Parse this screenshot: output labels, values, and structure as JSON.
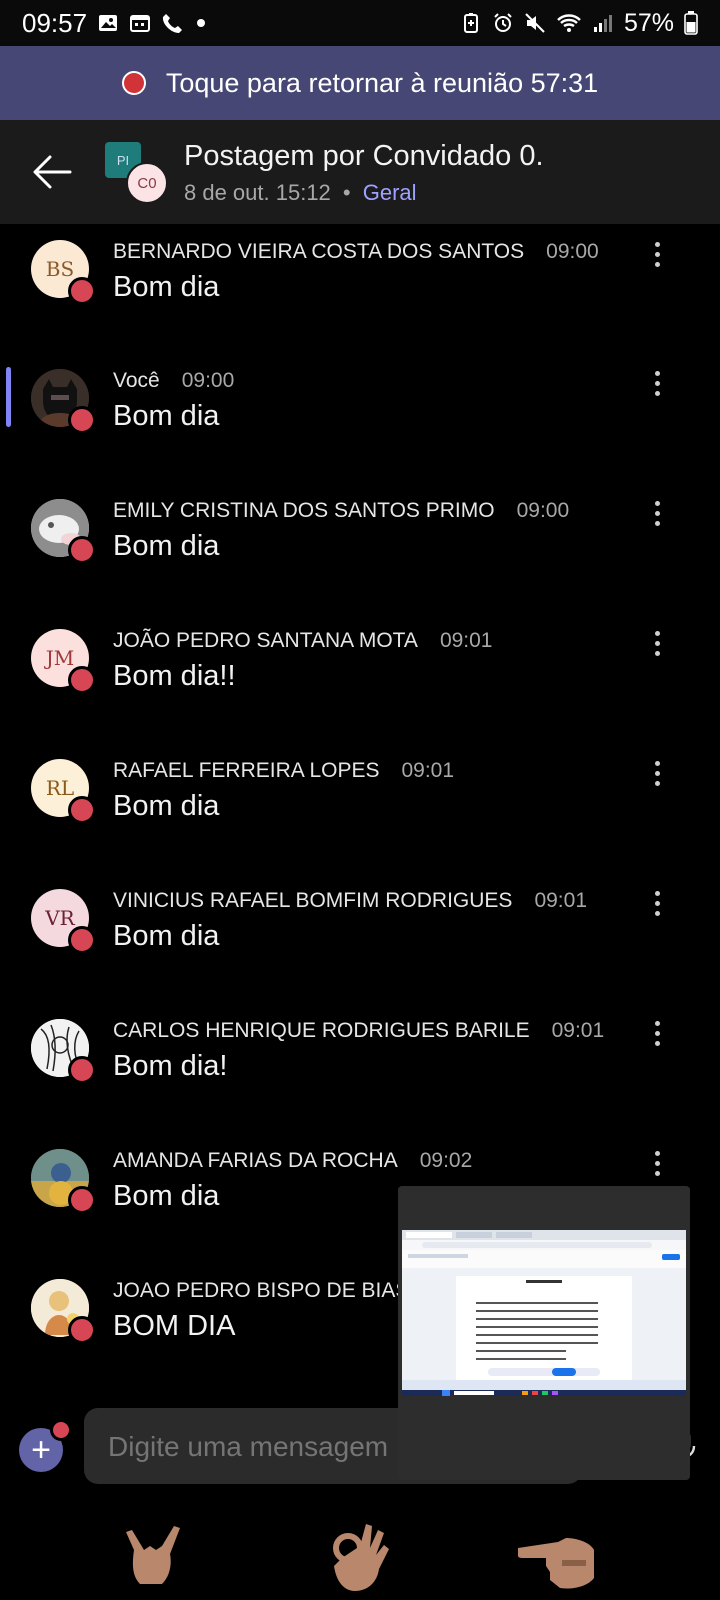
{
  "status_bar": {
    "time": "09:57",
    "battery": "57%"
  },
  "banner": {
    "text": "Toque para retornar à reunião 57:31"
  },
  "header": {
    "title": "Postagem por Convidado 0.",
    "date": "8 de out. 15:12",
    "separator": "•",
    "channel": "Geral",
    "avatar_team": "PI",
    "avatar_user": "C0"
  },
  "messages": [
    {
      "initials": "BS",
      "sender": "BERNARDO VIEIRA COSTA DOS SANTOS",
      "time": "09:00",
      "text": "Bom dia"
    },
    {
      "initials": "",
      "sender": "Você",
      "time": "09:00",
      "text": "Bom dia"
    },
    {
      "initials": "",
      "sender": "EMILY CRISTINA DOS SANTOS PRIMO",
      "time": "09:00",
      "text": "Bom dia"
    },
    {
      "initials": "JM",
      "sender": "JOÃO PEDRO SANTANA MOTA",
      "time": "09:01",
      "text": "Bom dia!!"
    },
    {
      "initials": "RL",
      "sender": "RAFAEL FERREIRA LOPES",
      "time": "09:01",
      "text": "Bom dia"
    },
    {
      "initials": "VR",
      "sender": "VINICIUS RAFAEL BOMFIM RODRIGUES",
      "time": "09:01",
      "text": "Bom dia"
    },
    {
      "initials": "",
      "sender": "CARLOS HENRIQUE RODRIGUES BARILE",
      "time": "09:01",
      "text": "Bom dia!"
    },
    {
      "initials": "",
      "sender": "AMANDA FARIAS DA ROCHA",
      "time": "09:02",
      "text": "Bom dia"
    },
    {
      "initials": "",
      "sender": "JOAO PEDRO BISPO DE BIAS",
      "time": "",
      "text": "BOM DIA"
    }
  ],
  "composer": {
    "placeholder": "Digite uma mensagem"
  },
  "colors": {
    "banner": "#464775",
    "accent": "#7f85f5",
    "presence_busy": "#d74654"
  }
}
